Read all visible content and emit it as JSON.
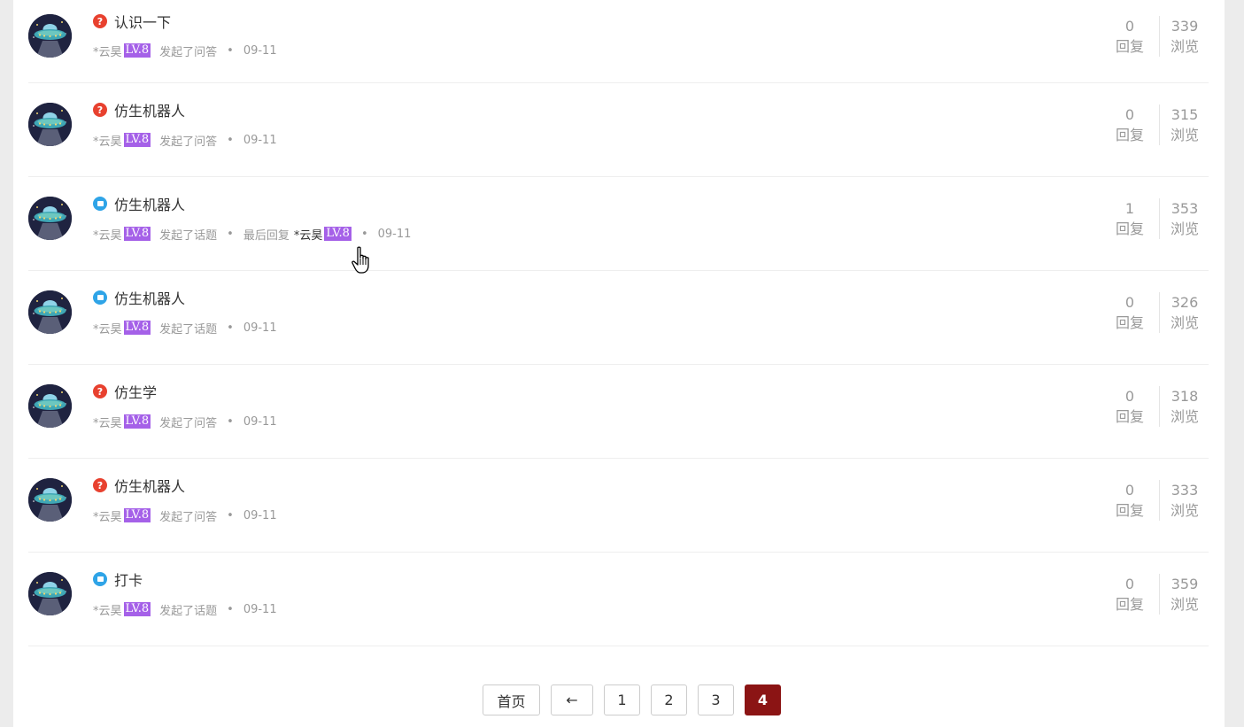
{
  "posts": [
    {
      "type": "question",
      "title": "认识一下",
      "author": "*云昊",
      "level": "LV.8",
      "action": "发起了问答",
      "last_reply_label": "",
      "last_reply_author": "",
      "last_reply_level": "",
      "date": "09-11",
      "replies": "0",
      "views": "339"
    },
    {
      "type": "question",
      "title": "仿生机器人",
      "author": "*云昊",
      "level": "LV.8",
      "action": "发起了问答",
      "last_reply_label": "",
      "last_reply_author": "",
      "last_reply_level": "",
      "date": "09-11",
      "replies": "0",
      "views": "315"
    },
    {
      "type": "topic",
      "title": "仿生机器人",
      "author": "*云昊",
      "level": "LV.8",
      "action": "发起了话题",
      "last_reply_label": "最后回复",
      "last_reply_author": "*云昊",
      "last_reply_level": "LV.8",
      "date": "09-11",
      "replies": "1",
      "views": "353"
    },
    {
      "type": "topic",
      "title": "仿生机器人",
      "author": "*云昊",
      "level": "LV.8",
      "action": "发起了话题",
      "last_reply_label": "",
      "last_reply_author": "",
      "last_reply_level": "",
      "date": "09-11",
      "replies": "0",
      "views": "326"
    },
    {
      "type": "question",
      "title": "仿生学",
      "author": "*云昊",
      "level": "LV.8",
      "action": "发起了问答",
      "last_reply_label": "",
      "last_reply_author": "",
      "last_reply_level": "",
      "date": "09-11",
      "replies": "0",
      "views": "318"
    },
    {
      "type": "question",
      "title": "仿生机器人",
      "author": "*云昊",
      "level": "LV.8",
      "action": "发起了问答",
      "last_reply_label": "",
      "last_reply_author": "",
      "last_reply_level": "",
      "date": "09-11",
      "replies": "0",
      "views": "333"
    },
    {
      "type": "topic",
      "title": "打卡",
      "author": "*云昊",
      "level": "LV.8",
      "action": "发起了话题",
      "last_reply_label": "",
      "last_reply_author": "",
      "last_reply_level": "",
      "date": "09-11",
      "replies": "0",
      "views": "359"
    }
  ],
  "labels": {
    "replies": "回复",
    "views": "浏览",
    "separator": "•"
  },
  "pagination": {
    "first": "首页",
    "prev": "←",
    "pages": [
      "1",
      "2",
      "3",
      "4"
    ],
    "current": "4"
  },
  "icons": {
    "question": "question-mark-icon",
    "topic": "speech-bubble-icon",
    "avatar": "ufo-avatar",
    "cursor": "hand-pointer-cursor"
  },
  "colors": {
    "question": "#e8412f",
    "topic": "#2fa4e7",
    "level_badge": "#a561e8",
    "active_page": "#8b1414"
  }
}
